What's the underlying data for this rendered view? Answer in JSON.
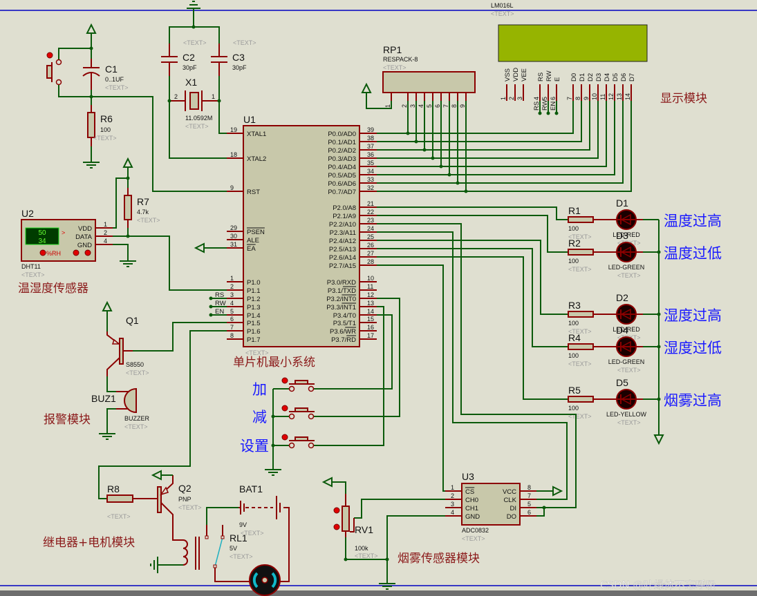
{
  "placeholder": "<TEXT>",
  "watermark": "CSDN @叶绿体不忘呼吸",
  "colors": {
    "background": "#dfdfd0",
    "wire": "#0b5a0b",
    "pin": "#8b0000",
    "component_body": "#c8c8aa",
    "lcd_screen": "#96b400",
    "module_label": "#8b1a1a",
    "indicator_label": "#1a1aff",
    "border": "#0000c0"
  },
  "u1": {
    "ref": "U1",
    "module_label": "单片机最小系统",
    "left_pins": [
      {
        "num": "19",
        "name": "XTAL1"
      },
      {
        "num": "18",
        "name": "XTAL2"
      },
      {
        "num": "9",
        "name": "RST"
      },
      {
        "num": "29",
        "name": "PSEN",
        "bar": "PSEN"
      },
      {
        "num": "30",
        "name": "ALE"
      },
      {
        "num": "31",
        "name": "EA",
        "bar": "EA"
      },
      {
        "num": "1",
        "name": "P1.0"
      },
      {
        "num": "2",
        "name": "P1.1"
      },
      {
        "num": "3",
        "name": "P1.2"
      },
      {
        "num": "4",
        "name": "P1.3"
      },
      {
        "num": "5",
        "name": "P1.4"
      },
      {
        "num": "6",
        "name": "P1.5"
      },
      {
        "num": "7",
        "name": "P1.6"
      },
      {
        "num": "8",
        "name": "P1.7"
      }
    ],
    "right_pins": [
      {
        "num": "39",
        "name": "P0.0/AD0"
      },
      {
        "num": "38",
        "name": "P0.1/AD1"
      },
      {
        "num": "37",
        "name": "P0.2/AD2"
      },
      {
        "num": "36",
        "name": "P0.3/AD3"
      },
      {
        "num": "35",
        "name": "P0.4/AD4"
      },
      {
        "num": "34",
        "name": "P0.5/AD5"
      },
      {
        "num": "33",
        "name": "P0.6/AD6"
      },
      {
        "num": "32",
        "name": "P0.7/AD7"
      },
      {
        "num": "21",
        "name": "P2.0/A8"
      },
      {
        "num": "22",
        "name": "P2.1/A9"
      },
      {
        "num": "23",
        "name": "P2.2/A10"
      },
      {
        "num": "24",
        "name": "P2.3/A11"
      },
      {
        "num": "25",
        "name": "P2.4/A12"
      },
      {
        "num": "26",
        "name": "P2.5/A13"
      },
      {
        "num": "27",
        "name": "P2.6/A14"
      },
      {
        "num": "28",
        "name": "P2.7/A15"
      },
      {
        "num": "10",
        "name": "P3.0/RXD"
      },
      {
        "num": "11",
        "name": "P3.1/TXD",
        "bar": "TXD"
      },
      {
        "num": "12",
        "name": "P3.2/INT0",
        "bar": "INT0"
      },
      {
        "num": "13",
        "name": "P3.3/INT1",
        "bar": "INT1"
      },
      {
        "num": "14",
        "name": "P3.4/T0"
      },
      {
        "num": "15",
        "name": "P3.5/T1"
      },
      {
        "num": "16",
        "name": "P3.6/WR",
        "bar": "WR"
      },
      {
        "num": "17",
        "name": "P3.7/RD",
        "bar": "RD"
      }
    ],
    "net_labels": [
      "RS",
      "RW",
      "EN"
    ]
  },
  "lcd": {
    "part": "LM016L",
    "module_label": "显示模块",
    "pins": [
      {
        "num": "1",
        "name": "VSS"
      },
      {
        "num": "2",
        "name": "VDD"
      },
      {
        "num": "3",
        "name": "VEE"
      },
      {
        "num": "4",
        "name": "RS"
      },
      {
        "num": "5",
        "name": "RW"
      },
      {
        "num": "6",
        "name": "E"
      },
      {
        "num": "7",
        "name": "D0"
      },
      {
        "num": "8",
        "name": "D1"
      },
      {
        "num": "9",
        "name": "D2"
      },
      {
        "num": "10",
        "name": "D3"
      },
      {
        "num": "11",
        "name": "D4"
      },
      {
        "num": "12",
        "name": "D5"
      },
      {
        "num": "13",
        "name": "D6"
      },
      {
        "num": "14",
        "name": "D7"
      }
    ],
    "net_labels": [
      "RS",
      "RW",
      "EN"
    ]
  },
  "rp1": {
    "ref": "RP1",
    "part": "RESPACK-8",
    "pins": [
      "1",
      "2",
      "3",
      "4",
      "5",
      "6",
      "7",
      "8",
      "9"
    ]
  },
  "crystal": {
    "c2": {
      "ref": "C2",
      "value": "30pF"
    },
    "c3": {
      "ref": "C3",
      "value": "30pF"
    },
    "x1": {
      "ref": "X1",
      "value": "11.0592M",
      "pins": [
        "2",
        "1"
      ]
    }
  },
  "reset": {
    "c1": {
      "ref": "C1",
      "value": "0..1UF"
    },
    "r6": {
      "ref": "R6",
      "value": "100"
    }
  },
  "dht": {
    "ref": "U2",
    "part": "DHT11",
    "module_label": "温湿度传感器",
    "reading_top": "50",
    "reading_bottom": "34",
    "unit": "%RH",
    "arrow": ">",
    "pins": [
      {
        "num": "1",
        "name": "VDD"
      },
      {
        "num": "2",
        "name": "DATA"
      },
      {
        "num": "4",
        "name": "GND"
      }
    ],
    "r7": {
      "ref": "R7",
      "value": "4.7k"
    }
  },
  "alarm": {
    "module_label": "报警模块",
    "q1": {
      "ref": "Q1",
      "part": "S8550"
    },
    "buzzer": {
      "ref": "BUZ1",
      "part": "BUZZER"
    }
  },
  "relay": {
    "module_label": "继电器+电机模块",
    "r8": {
      "ref": "R8"
    },
    "q2": {
      "ref": "Q2",
      "part": "PNP"
    },
    "bat": {
      "ref": "BAT1",
      "value": "9V"
    },
    "rl": {
      "ref": "RL1",
      "value": "5V"
    }
  },
  "buttons": [
    {
      "label": "加"
    },
    {
      "label": "减"
    },
    {
      "label": "设置"
    }
  ],
  "leds": [
    {
      "r_ref": "R1",
      "r_value": "100",
      "d_ref": "D1",
      "d_part": "LED-RED",
      "label": "温度过高"
    },
    {
      "r_ref": "R2",
      "r_value": "100",
      "d_ref": "D3",
      "d_part": "LED-GREEN",
      "label": "温度过低"
    },
    {
      "r_ref": "R3",
      "r_value": "100",
      "d_ref": "D2",
      "d_part": "LED-RED",
      "label": "湿度过高"
    },
    {
      "r_ref": "R4",
      "r_value": "100",
      "d_ref": "D4",
      "d_part": "LED-GREEN",
      "label": "湿度过低"
    },
    {
      "r_ref": "R5",
      "r_value": "100",
      "d_ref": "D5",
      "d_part": "LED-YELLOW",
      "label": "烟雾过高"
    }
  ],
  "adc": {
    "ref": "U3",
    "part": "ADC0832",
    "module_label": "烟雾传感器模块",
    "left_pins": [
      {
        "num": "1",
        "name": "CS",
        "bar": "CS"
      },
      {
        "num": "2",
        "name": "CH0"
      },
      {
        "num": "3",
        "name": "CH1"
      },
      {
        "num": "4",
        "name": "GND"
      }
    ],
    "right_pins": [
      {
        "num": "8",
        "name": "VCC"
      },
      {
        "num": "7",
        "name": "CLK"
      },
      {
        "num": "5",
        "name": "DI"
      },
      {
        "num": "6",
        "name": "DO"
      }
    ],
    "rv1": {
      "ref": "RV1",
      "value": "100k"
    }
  }
}
